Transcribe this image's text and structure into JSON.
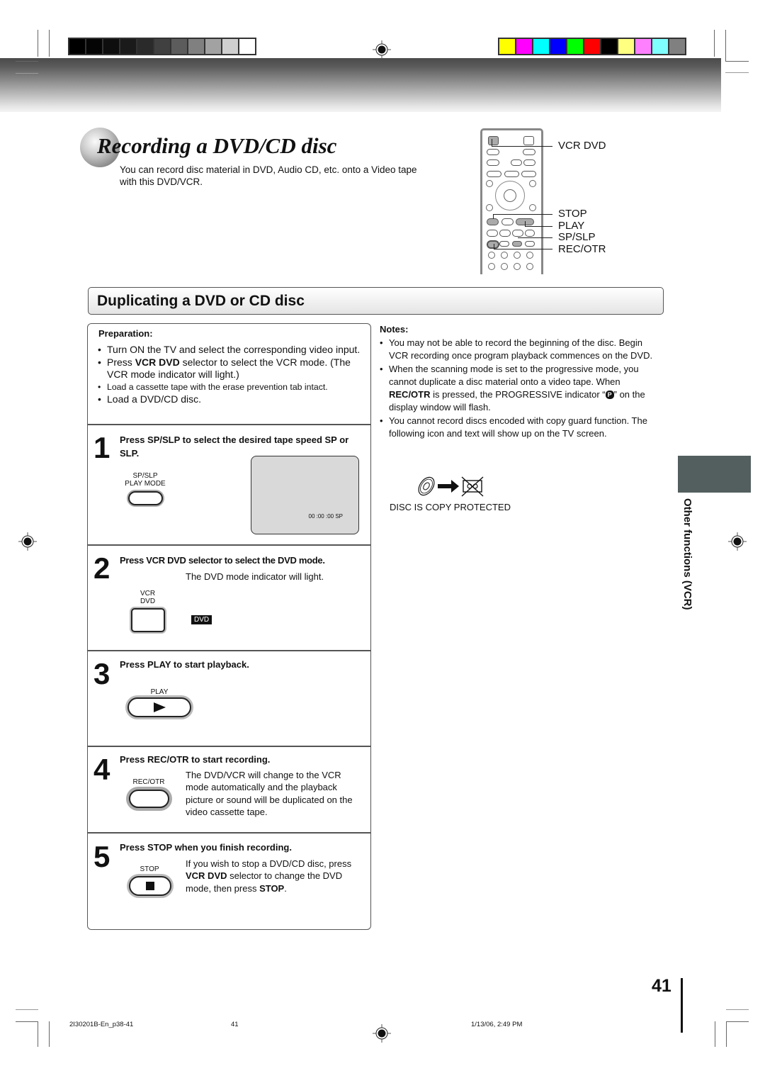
{
  "print_marks": {
    "grayscale_swatches": [
      "#000000",
      "#050505",
      "#0e0e0e",
      "#1a1a1a",
      "#2a2a2a",
      "#404040",
      "#5c5c5c",
      "#808080",
      "#a2a2a2",
      "#cfcfcf",
      "#ffffff"
    ],
    "color_swatches": [
      "#ffff00",
      "#ff00ff",
      "#00ffff",
      "#0000ff",
      "#00ff00",
      "#ff0000",
      "#000000",
      "#ffff80",
      "#ff80ff",
      "#80ffff",
      "#808080"
    ]
  },
  "header": {
    "title": "Recording a DVD/CD disc",
    "intro": "You can record disc material in DVD, Audio CD, etc. onto a Video tape with this DVD/VCR."
  },
  "remote_labels": {
    "vcr_dvd": "VCR DVD",
    "stop": "STOP",
    "play": "PLAY",
    "sp_slp": "SP/SLP",
    "rec_otr": "REC/OTR"
  },
  "section": {
    "title": "Duplicating a DVD or CD disc"
  },
  "preparation": {
    "heading": "Preparation:",
    "items": [
      {
        "pre": "Turn ON the TV and select the corresponding video input.",
        "bold": "",
        "post": ""
      },
      {
        "pre": "Press ",
        "bold": "VCR DVD",
        "post": " selector to select the VCR mode. (The VCR mode indicator will light.)"
      },
      {
        "pre": "Load a cassette tape with the erase prevention tab intact.",
        "bold": "",
        "post": ""
      },
      {
        "pre": "Load a DVD/CD disc.",
        "bold": "",
        "post": ""
      }
    ]
  },
  "steps": [
    {
      "number": "1",
      "heading": "Press SP/SLP to select the desired tape speed SP or SLP.",
      "button_label_1": "SP/SLP",
      "button_label_2": "PLAY MODE",
      "screen_text": "00 :00 :00  SP"
    },
    {
      "number": "2",
      "heading": "Press VCR DVD selector to select the DVD mode.",
      "body": "The DVD mode indicator will light.",
      "button_label_1": "VCR",
      "button_label_2": "DVD",
      "indicator": "DVD"
    },
    {
      "number": "3",
      "heading": "Press PLAY to start playback.",
      "button_label": "PLAY"
    },
    {
      "number": "4",
      "heading": "Press REC/OTR to start recording.",
      "button_label": "REC/OTR",
      "body": "The DVD/VCR will change to the VCR mode automatically and the playback picture or sound will be duplicated on the video cassette tape."
    },
    {
      "number": "5",
      "heading": "Press STOP when you finish recording.",
      "button_label": "STOP",
      "body_1": "If you wish to stop a DVD/CD disc, press ",
      "body_bold_1": "VCR DVD",
      "body_2": " selector to change the DVD mode, then press ",
      "body_bold_2": "STOP",
      "body_3": "."
    }
  ],
  "notes": {
    "heading": "Notes:",
    "note1": "You may not be able to record the beginning of the disc. Begin VCR recording once program playback commences on the DVD.",
    "note2_a": "When the scanning mode is set to the progressive mode, you cannot duplicate a disc material onto a video tape. When ",
    "note2_bold": "REC/OTR",
    "note2_b": " is pressed, the PROGRESSIVE indicator “",
    "note2_badge": "P",
    "note2_c": "” on the display window will flash.",
    "note3": "You cannot record discs encoded with copy guard function. The following icon and text will show up on the TV screen.",
    "copy_protected_text": "DISC IS COPY PROTECTED"
  },
  "side_tab": {
    "label": "Other functions (VCR)",
    "color": "#535e5e"
  },
  "page_number": "41",
  "footer": {
    "file": "2I30201B-En_p38-41",
    "page": "41",
    "timestamp": "1/13/06, 2:49 PM"
  }
}
